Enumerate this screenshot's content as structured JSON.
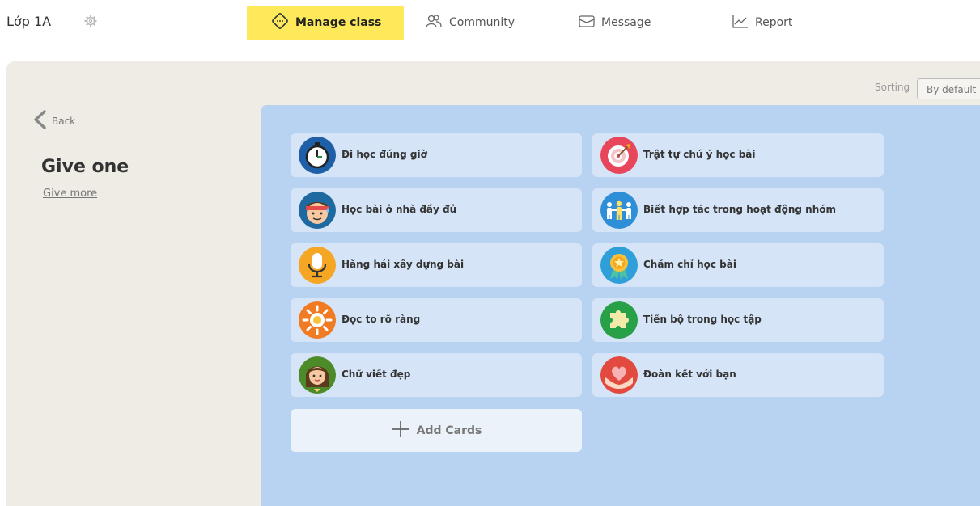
{
  "header": {
    "class_name": "Lớp 1A",
    "nav": [
      {
        "label": "Manage class",
        "icon": "manage-class-icon",
        "active": true
      },
      {
        "label": "Community",
        "icon": "community-icon",
        "active": false
      },
      {
        "label": "Message",
        "icon": "message-icon",
        "active": false
      },
      {
        "label": "Report",
        "icon": "report-icon",
        "active": false
      }
    ]
  },
  "sorting": {
    "label": "Sorting",
    "value": "By default"
  },
  "sidebar": {
    "back_label": "Back",
    "title": "Give one",
    "give_more_label": "Give more"
  },
  "cards": [
    {
      "label": "Đi học đúng giờ",
      "icon": "clock-icon",
      "color": "#1f5fa8"
    },
    {
      "label": "Trật tự chú ý học bài",
      "icon": "target-icon",
      "color": "#e8465b"
    },
    {
      "label": "Học bài ở nhà đầy đủ",
      "icon": "student-face-icon",
      "color": "#1e6aa0"
    },
    {
      "label": "Biết hợp tác trong hoạt động nhóm",
      "icon": "teamwork-icon",
      "color": "#2e8fd8"
    },
    {
      "label": "Hăng hái xây dựng bài",
      "icon": "microphone-icon",
      "color": "#f5a623"
    },
    {
      "label": "Chăm chỉ học bài",
      "icon": "medal-icon",
      "color": "#2e9fd8"
    },
    {
      "label": "Đọc to rõ ràng",
      "icon": "sun-icon",
      "color": "#f07b22"
    },
    {
      "label": "Tiến bộ trong học tập",
      "icon": "puzzle-icon",
      "color": "#27a048"
    },
    {
      "label": "Chữ viết đẹp",
      "icon": "girl-face-icon",
      "color": "#4d8a2a"
    },
    {
      "label": "Đoàn kết với bạn",
      "icon": "heart-hands-icon",
      "color": "#e24a3f"
    }
  ],
  "add_card_label": "Add Cards",
  "colors": {
    "accent": "#fde95a",
    "panel": "#efebe5",
    "cards_area": "#b8d3f1",
    "card": "#d5e4f6"
  }
}
